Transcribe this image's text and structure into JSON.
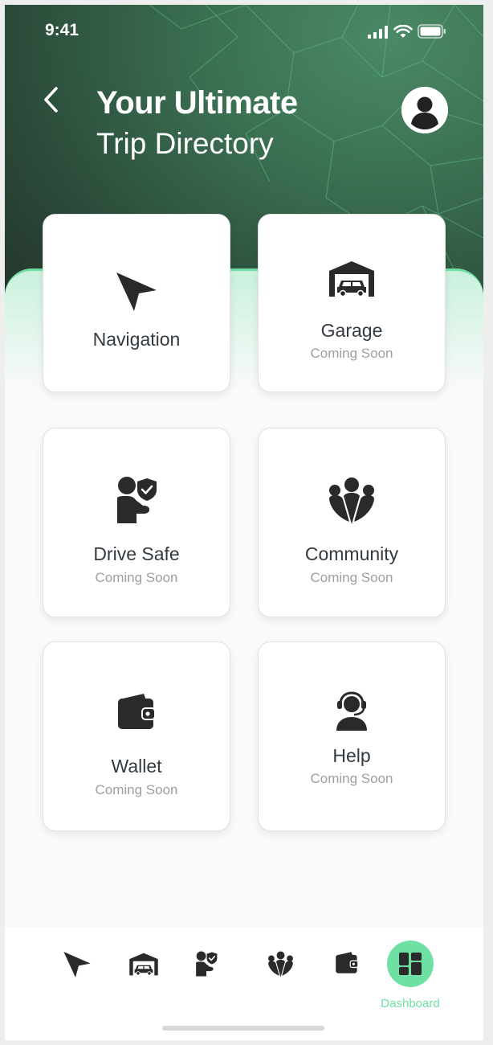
{
  "status_bar": {
    "time": "9:41"
  },
  "header": {
    "title_line1": "Your Ultimate",
    "title_line2": "Trip Directory"
  },
  "cards": [
    {
      "label": "Navigation",
      "sub": "",
      "icon": "navigation-arrow-icon"
    },
    {
      "label": "Garage",
      "sub": "Coming Soon",
      "icon": "garage-icon"
    },
    {
      "label": "Drive Safe",
      "sub": "Coming Soon",
      "icon": "drive-safe-icon"
    },
    {
      "label": "Community",
      "sub": "Coming Soon",
      "icon": "community-icon"
    },
    {
      "label": "Wallet",
      "sub": "Coming Soon",
      "icon": "wallet-icon"
    },
    {
      "label": "Help",
      "sub": "Coming Soon",
      "icon": "help-headset-icon"
    }
  ],
  "bottom_nav": {
    "items": [
      "navigation-arrow-icon",
      "garage-icon",
      "drive-safe-icon",
      "community-icon",
      "wallet-icon",
      "dashboard-icon"
    ],
    "active_label": "Dashboard"
  },
  "colors": {
    "accent": "#6ee0a4",
    "header_dark": "#2b4a39",
    "icon_dark": "#2a2a2a",
    "text_primary": "#333a40",
    "text_muted": "#9aa0a4"
  }
}
